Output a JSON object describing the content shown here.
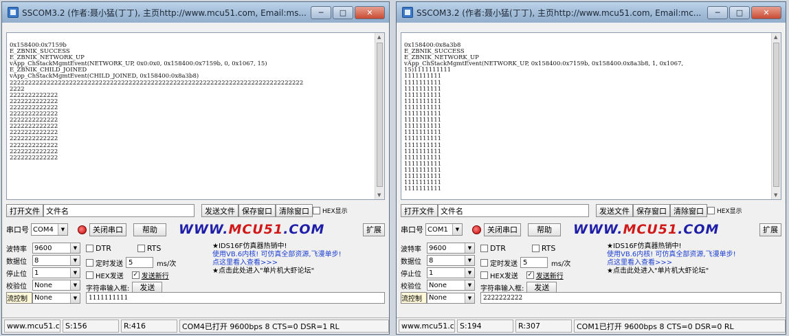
{
  "windows": [
    {
      "title": "SSCOM3.2 (作者:聂小猛(丁丁), 主页http://www.mcu51.com, Email:ms...",
      "receive_text": "0x158400:0x7159b\nE_ZBNIK_SUCCESS\nE_ZBNIK_NETWORK_UP\nvApp_ChStackMgmtEvent(NETWORK_UP, 0x0:0x0, 0x158400:0x7159b, 0, 0x1067, 15)\nE_ZBNIK_CHILD_JOINED\nvApp_ChStackMgmtEvent(CHILD_JOINED, 0x158400:0x8a3b8)\n2222222222222222222222222222222222222222222222222222222222222222222222222222222\n2222\n2222222222222\n2222222222222\n2222222222222\n2222222222222\n2222222222222\n2222222222222\n2222222222222\n2222222222222\n2222222222222\n2222222222222\n2222222222222",
      "open_file_label": "打开文件",
      "filename_label": "文件名",
      "send_file_label": "发送文件",
      "save_window_label": "保存窗口",
      "clear_window_label": "清除窗口",
      "hex_display_label": "HEX显示",
      "port_label": "串口号",
      "port_value": "COM4",
      "close_port_label": "关闭串口",
      "help_label": "帮助",
      "brand_a": "WWW.",
      "brand_b": "MCU51",
      "brand_c": ".COM",
      "expand_label": "扩展",
      "baud_label": "波特率",
      "baud_value": "9600",
      "databits_label": "数据位",
      "databits_value": "8",
      "stopbits_label": "停止位",
      "stopbits_value": "1",
      "parity_label": "校验位",
      "parity_value": "None",
      "flow_label": "流控制",
      "flow_value": "None",
      "dtr_label": "DTR",
      "rts_label": "RTS",
      "timed_send_label": "定时发送",
      "interval_value": "5",
      "interval_unit": "ms/次",
      "hex_send_label": "HEX发送",
      "send_newline_label": "发送新行",
      "input_label": "字符串输入框:",
      "send_label": "发送",
      "send_input_value": "1111111111",
      "ad_line1": "★IDS16F仿真器热销中!",
      "ad_line2": "使用VB.6内核! 可仿真全部资源,飞漫单步!",
      "ad_line3": "点这里看入查看>>>",
      "ad_line4": "★点击此处进入\"单片机大虾论坛\"",
      "status_site": "www.mcu51.cor",
      "status_s": "S:156",
      "status_r": "R:416",
      "status_port": "COM4已打开 9600bps 8 CTS=0 DSR=1 RL"
    },
    {
      "title": "SSCOM3.2 (作者:聂小猛(丁丁), 主页http://www.mcu51.com, Email:mc...",
      "receive_text": "0x158400:0x8a3b8\nE_ZBNIK_SUCCESS\nE_ZBNIK_NETWORK_UP\nvApp_ChStackMgmtEvent(NETWORK_UP, 0x158400:0x7159b, 0x158400:0x8a3b8, 1, 0x1067,\n15)1111111111\n1111111111\n1111111111\n1111111111\n1111111111\n1111111111\n1111111111\n1111111111\n1111111111\n1111111111\n1111111111\n1111111111\n1111111111\n1111111111\n1111111111\n1111111111\n1111111111\n1111111111\n1111111111\n1111111111",
      "open_file_label": "打开文件",
      "filename_label": "文件名",
      "send_file_label": "发送文件",
      "save_window_label": "保存窗口",
      "clear_window_label": "清除窗口",
      "hex_display_label": "HEX显示",
      "port_label": "串口号",
      "port_value": "COM1",
      "close_port_label": "关闭串口",
      "help_label": "帮助",
      "brand_a": "WWW.",
      "brand_b": "MCU51",
      "brand_c": ".COM",
      "expand_label": "扩展",
      "baud_label": "波特率",
      "baud_value": "9600",
      "databits_label": "数据位",
      "databits_value": "8",
      "stopbits_label": "停止位",
      "stopbits_value": "1",
      "parity_label": "校验位",
      "parity_value": "None",
      "flow_label": "流控制",
      "flow_value": "None",
      "dtr_label": "DTR",
      "rts_label": "RTS",
      "timed_send_label": "定时发送",
      "interval_value": "5",
      "interval_unit": "ms/次",
      "hex_send_label": "HEX发送",
      "send_newline_label": "发送新行",
      "input_label": "字符串输入框:",
      "send_label": "发送",
      "send_input_value": "2222222222",
      "ad_line1": "★IDS16F仿真器热销中!",
      "ad_line2": "使用VB.6内核! 可仿真全部资源,飞漫单步!",
      "ad_line3": "点这里看入查看>>>",
      "ad_line4": "★点击此处进入\"单片机大虾论坛\"",
      "status_site": "www.mcu51.cor",
      "status_s": "S:194",
      "status_r": "R:307",
      "status_port": "COM1已打开 9600bps 8 CTS=0 DSR=0 RL"
    }
  ],
  "colors": {
    "title_gradient": "#9fbad6",
    "brand_blue": "#1e1ea8",
    "brand_red": "#d01818",
    "ad_link": "#1d3fd0",
    "close_button": "#c84a33"
  },
  "icons": {
    "app": "serial-port-app-icon",
    "minimize": "minimize-icon",
    "maximize": "maximize-icon",
    "close": "close-icon",
    "lamp": "port-status-lamp-icon",
    "dropdown": "chevron-down-icon"
  }
}
